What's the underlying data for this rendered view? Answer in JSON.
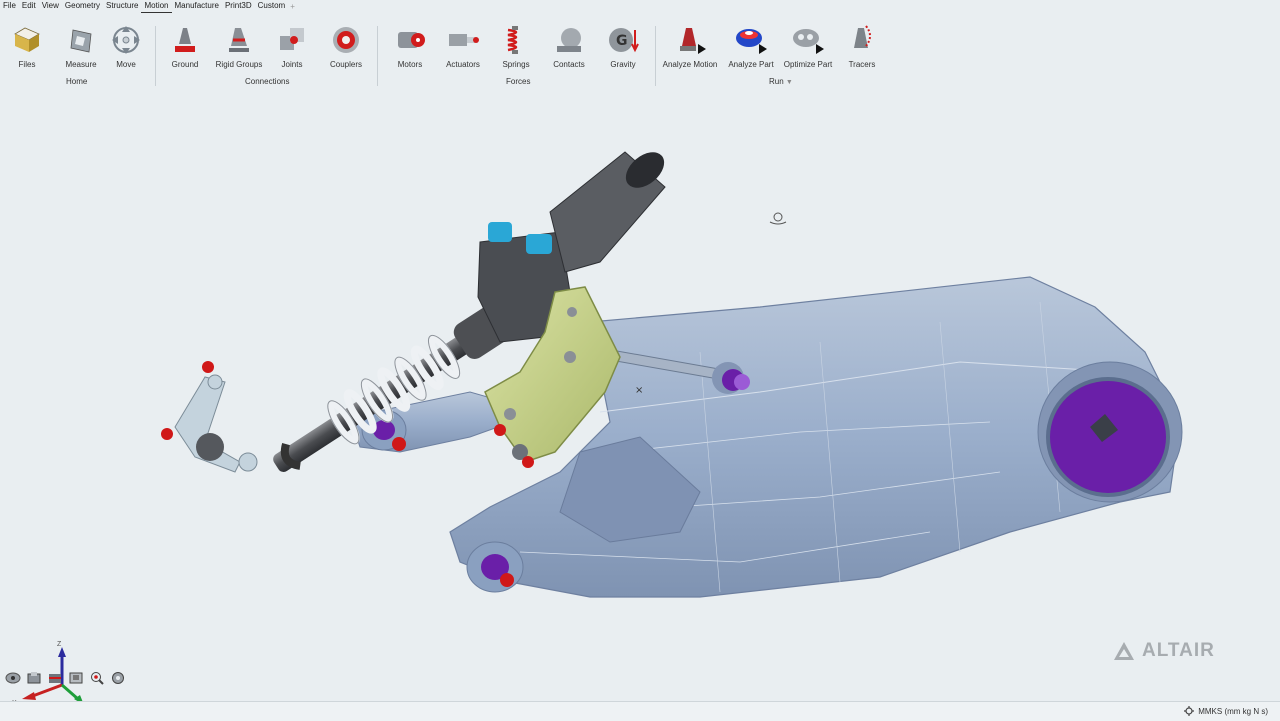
{
  "menu": {
    "items": [
      "File",
      "Edit",
      "View",
      "Geometry",
      "Structure",
      "Motion",
      "Manufacture",
      "Print3D",
      "Custom"
    ],
    "active": "Motion",
    "add_symbol": "+"
  },
  "ribbon": {
    "tools": {
      "files": "Files",
      "measure": "Measure",
      "move": "Move",
      "ground": "Ground",
      "rigid_groups": "Rigid Groups",
      "joints": "Joints",
      "couplers": "Couplers",
      "motors": "Motors",
      "actuators": "Actuators",
      "springs": "Springs",
      "contacts": "Contacts",
      "gravity": "Gravity",
      "analyze_motion": "Analyze Motion",
      "analyze_part": "Analyze Part",
      "optimize_part": "Optimize Part",
      "tracers": "Tracers"
    },
    "groups": {
      "home": "Home",
      "connections": "Connections",
      "forces": "Forces",
      "run": "Run"
    }
  },
  "viewport": {
    "triad_axes": {
      "z": "Z",
      "x": "X",
      "y": "Y"
    },
    "brand": "ALTAIR"
  },
  "status": {
    "units": "MMKS (mm kg N s)"
  },
  "colors": {
    "background": "#e9eef1",
    "swingarm": "#9fb2cc",
    "bracket": "#c9d48f",
    "pivot_purple": "#6a1fa8",
    "ground_red": "#d01818",
    "fitting_blue": "#2aa7d6"
  }
}
